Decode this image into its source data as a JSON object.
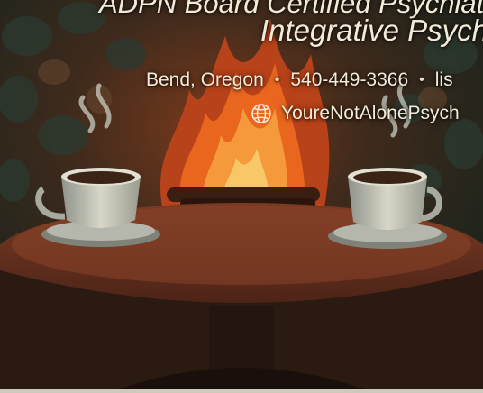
{
  "banner": {
    "title_line_1": "ADPN Board Certified Psychiatric",
    "title_line_2": "Integrative Psych",
    "location": "Bend, Oregon",
    "phone": "540-449-3366",
    "email": "lis",
    "website": "YoureNotAlonePsych",
    "separator": "•"
  },
  "icons": {
    "website": "globe-icon"
  },
  "colors": {
    "text": "#f3ead8",
    "background": "#1c2a22",
    "fire": "#e8661e"
  }
}
